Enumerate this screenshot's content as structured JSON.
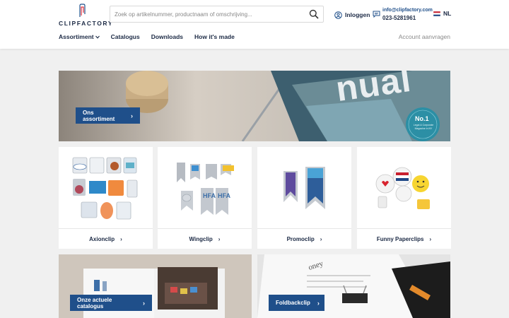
{
  "header": {
    "logo_text": "CLIPFACTORY",
    "search_placeholder": "Zoek op artikelnummer, productnaam of omschrijving...",
    "login_label": "Inloggen",
    "contact_email": "info@clipfactory.com",
    "contact_phone": "023-5281961",
    "language": "NL"
  },
  "nav": {
    "items": [
      "Assortiment",
      "Catalogus",
      "Downloads",
      "How it's made"
    ],
    "account_label": "Account aanvragen"
  },
  "hero": {
    "button_label": "Ons assortiment",
    "magazine_text": "nual",
    "badge_title": "No.1",
    "badge_sub": "Legal & Corporate Magazine in NY"
  },
  "cards": [
    {
      "label": "Axionclip"
    },
    {
      "label": "Wingclip"
    },
    {
      "label": "Promoclip"
    },
    {
      "label": "Funny Paperclips"
    }
  ],
  "banners": [
    {
      "label": "Onze actuele catalogus"
    },
    {
      "label": "Foldbackclip"
    }
  ],
  "colors": {
    "brand_blue": "#1f4f8a",
    "navy": "#1c2a45",
    "background": "#f0f0f0"
  }
}
